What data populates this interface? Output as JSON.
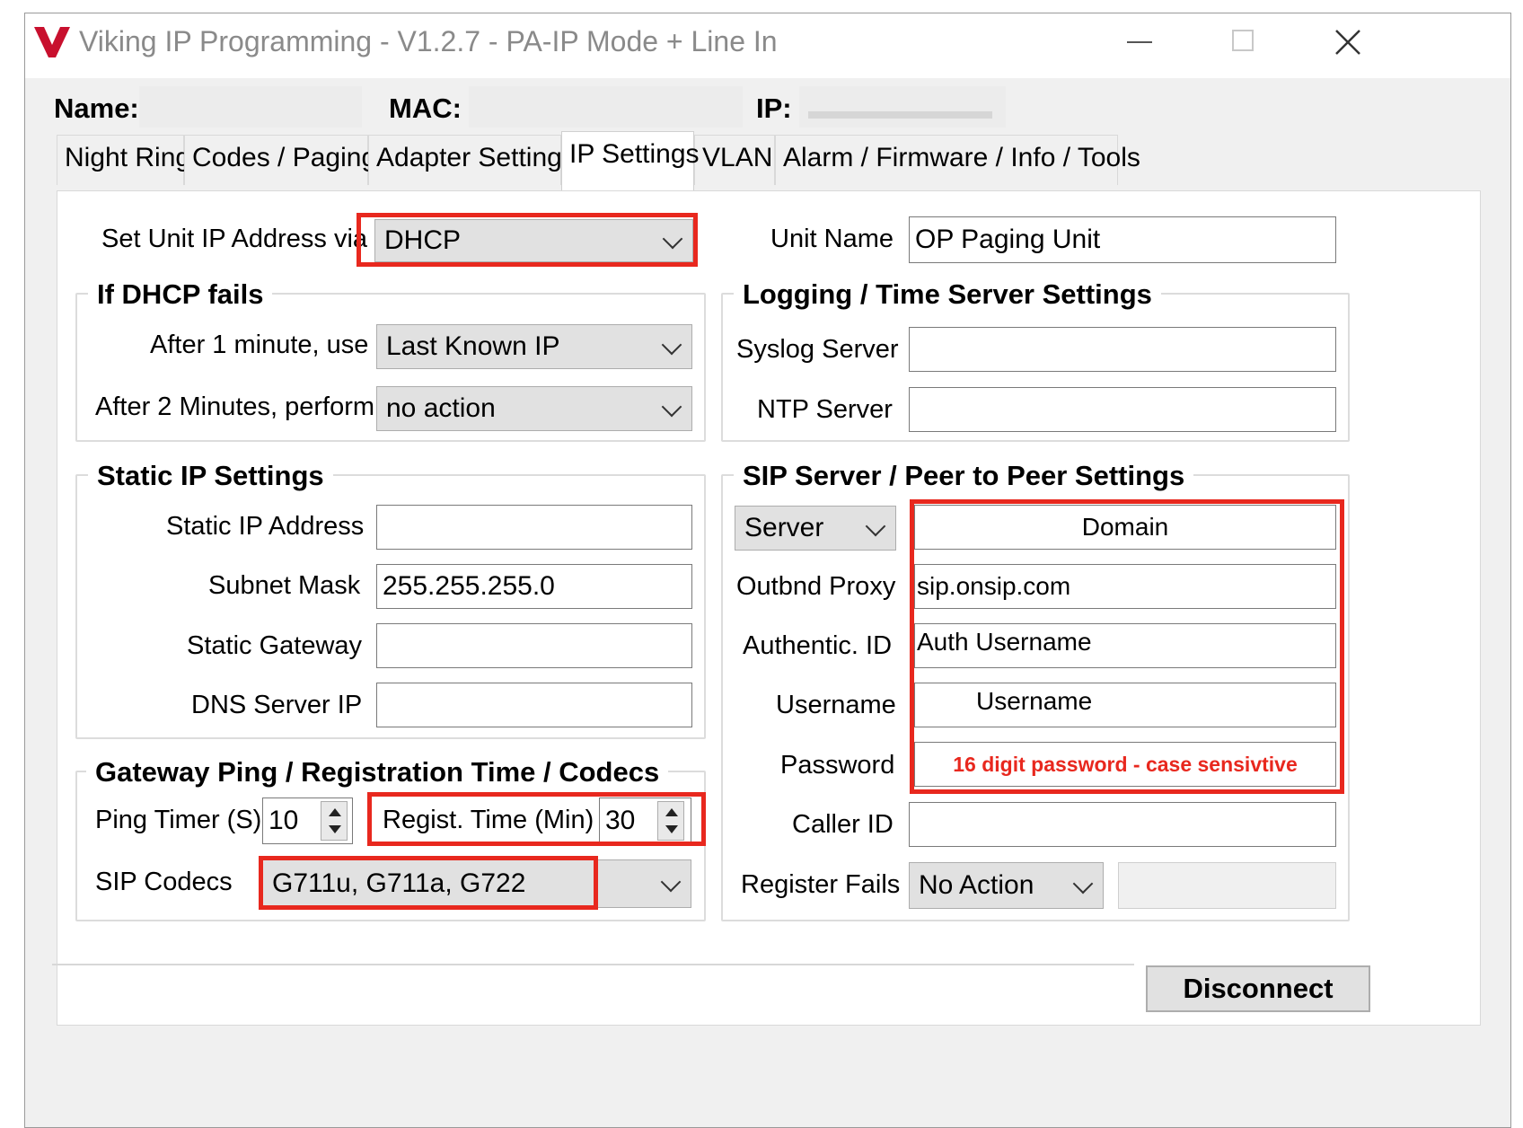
{
  "window": {
    "title": "Viking IP Programming - V1.2.7 - PA-IP Mode + Line In",
    "logo_letter": "V",
    "accent": "#c8102e"
  },
  "header": {
    "name_label": "Name:",
    "mac_label": "MAC:",
    "ip_label": "IP:"
  },
  "tabs": [
    {
      "label": "Night Ring"
    },
    {
      "label": "Codes / Paging"
    },
    {
      "label": "Adapter Settings"
    },
    {
      "label": "IP Settings",
      "active": true
    },
    {
      "label": "VLAN"
    },
    {
      "label": "Alarm / Firmware / Info / Tools"
    }
  ],
  "ip_mode": {
    "label": "Set Unit IP Address via",
    "value": "DHCP"
  },
  "unit_name": {
    "label": "Unit Name",
    "value": "OP Paging Unit"
  },
  "dhcp_fails": {
    "title": "If DHCP fails",
    "after1_label": "After 1 minute, use",
    "after1_value": "Last Known IP",
    "after2_label": "After 2 Minutes, perform",
    "after2_value": "no action"
  },
  "logging": {
    "title": "Logging / Time Server Settings",
    "syslog_label": "Syslog Server",
    "syslog_value": "",
    "ntp_label": "NTP Server",
    "ntp_value": ""
  },
  "static_ip": {
    "title": "Static IP Settings",
    "address_label": "Static IP Address",
    "address_value": "",
    "subnet_label": "Subnet Mask",
    "subnet_value": "255.255.255.0",
    "gateway_label": "Static Gateway",
    "gateway_value": "",
    "dns_label": "DNS Server IP",
    "dns_value": ""
  },
  "sip": {
    "title": "SIP Server / Peer to Peer Settings",
    "mode_value": "Server",
    "domain_value": "Domain",
    "proxy_label": "Outbnd Proxy",
    "proxy_value": "sip.onsip.com",
    "auth_label": "Authentic. ID",
    "auth_value": "Auth Username",
    "username_label": "Username",
    "username_value": "Username",
    "password_label": "Password",
    "password_value": "16 digit password - case sensivtive",
    "callerid_label": "Caller ID",
    "callerid_value": "",
    "regfail_label": "Register Fails",
    "regfail_value": "No Action"
  },
  "gateway": {
    "title": "Gateway Ping / Registration Time / Codecs",
    "ping_label": "Ping Timer (S)",
    "ping_value": "10",
    "regist_label": "Regist. Time (Min)",
    "regist_value": "30",
    "codecs_label": "SIP Codecs",
    "codecs_value": "G711u, G711a, G722"
  },
  "footer": {
    "disconnect_label": "Disconnect"
  },
  "colors": {
    "highlight": "#e8281e",
    "password_text": "#e8281e"
  }
}
